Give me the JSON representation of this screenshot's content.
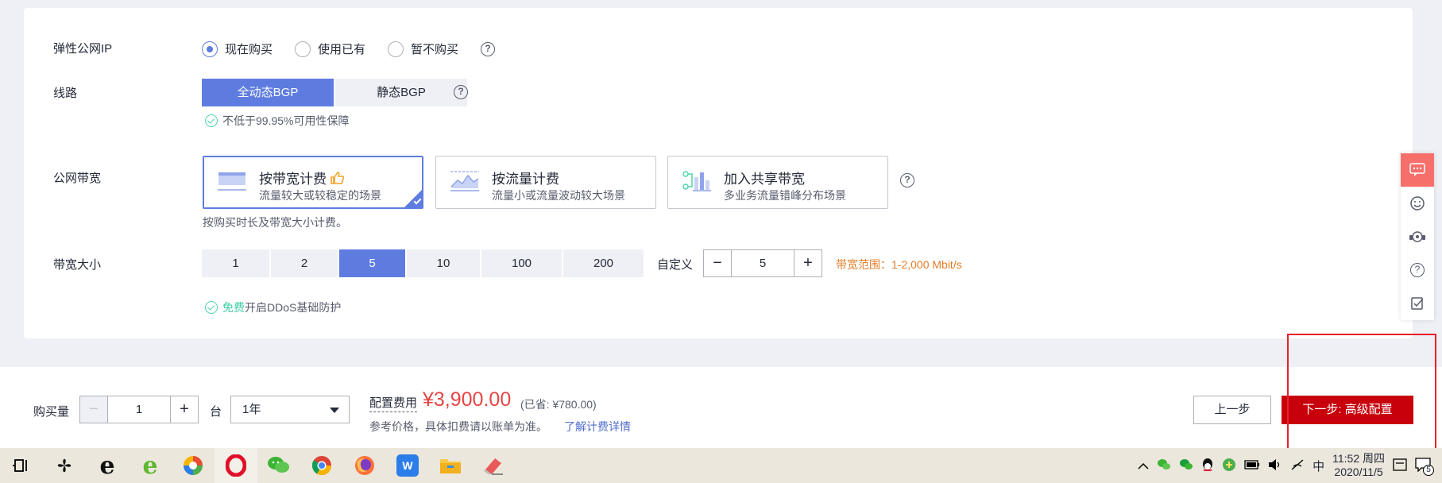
{
  "eip": {
    "label": "弹性公网IP",
    "options": [
      "现在购买",
      "使用已有",
      "暂不购买"
    ],
    "selected": 0,
    "help": "?"
  },
  "line": {
    "label": "线路",
    "options": [
      "全动态BGP",
      "静态BGP"
    ],
    "selected": 0,
    "note": "不低于99.95%可用性保障",
    "help": "?"
  },
  "bandwidth_billing": {
    "label": "公网带宽",
    "cards": [
      {
        "title": "按带宽计费",
        "desc": "流量较大或较稳定的场景",
        "icon": "bandwidth-chart-icon",
        "badge_icon": "thumbs-up-icon"
      },
      {
        "title": "按流量计费",
        "desc": "流量小或流量波动较大场景",
        "icon": "traffic-chart-icon"
      },
      {
        "title": "加入共享带宽",
        "desc": "多业务流量错峰分布场景",
        "icon": "shared-bandwidth-icon"
      }
    ],
    "selected": 0,
    "note": "按购买时长及带宽大小计费。",
    "help": "?"
  },
  "bandwidth_size": {
    "label": "带宽大小",
    "options": [
      "1",
      "2",
      "5",
      "10",
      "100",
      "200"
    ],
    "selected": 2,
    "custom_label": "自定义",
    "custom_value": "5",
    "range_text": "带宽范围：1-2,000 Mbit/s",
    "note_green": "免费",
    "note_rest": "开启DDoS基础防护"
  },
  "float_bar": [
    "chat-icon",
    "smile-icon",
    "headset-icon",
    "help-icon",
    "feedback-icon"
  ],
  "footer": {
    "qty_label": "购买量",
    "qty_value": "1",
    "unit": "台",
    "duration": "1年",
    "fee_label": "配置费用",
    "price": "¥3,900.00",
    "saved": "(已省: ¥780.00)",
    "note": "参考价格，具体扣费请以账单为准。",
    "link": "了解计费详情",
    "prev": "上一步",
    "next": "下一步: 高级配置"
  },
  "taskbar": {
    "time": "11:52 周四",
    "date": "2020/11/5",
    "lang": "中",
    "notif": "5"
  },
  "colors": {
    "accent": "#5e7ce0",
    "danger": "#c7000b",
    "price": "#e54545",
    "range": "#e37d29",
    "link": "#526ecc",
    "ok": "#3dcca6"
  }
}
